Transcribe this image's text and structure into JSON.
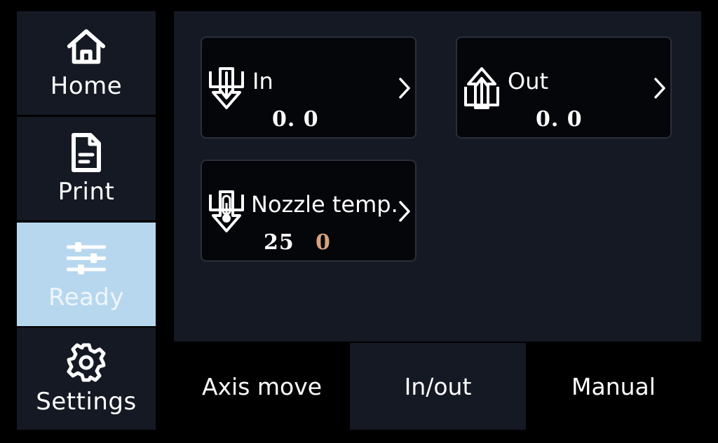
{
  "sidebar": {
    "items": [
      {
        "label": "Home",
        "icon": "home-icon"
      },
      {
        "label": "Print",
        "icon": "file-icon"
      },
      {
        "label": "Ready",
        "icon": "sliders-icon",
        "active": true
      },
      {
        "label": "Settings",
        "icon": "gear-icon"
      }
    ]
  },
  "cards": {
    "in": {
      "label": "In",
      "value": "0. 0",
      "icon": "extrude-in-icon"
    },
    "out": {
      "label": "Out",
      "value": "0. 0",
      "icon": "retract-out-icon"
    },
    "nozzle": {
      "label": "Nozzle temp.",
      "current": "25",
      "target": "0",
      "icon": "nozzle-thermometer-icon"
    }
  },
  "tabs": [
    {
      "label": "Axis move"
    },
    {
      "label": "In/out",
      "active": true
    },
    {
      "label": "Manual"
    }
  ],
  "colors": {
    "panel": "#151923",
    "card": "#05060a",
    "active_nav": "#b7d7ef",
    "target_temp": "#d8a27e"
  }
}
